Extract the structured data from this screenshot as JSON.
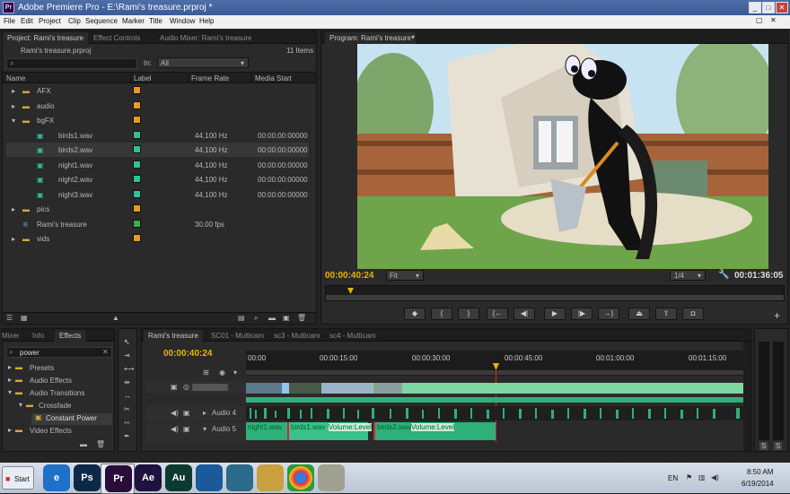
{
  "window": {
    "title": "Adobe Premiere Pro - E:\\Rami's treasure.prproj *",
    "app_icon": "Pr"
  },
  "menu": [
    "File",
    "Edit",
    "Project",
    "Clip",
    "Sequence",
    "Marker",
    "Title",
    "Window",
    "Help"
  ],
  "project_panel": {
    "tabs": [
      "Project: Rami's treasure",
      "Effect Controls",
      "Audio Mixer: Rami's treasure"
    ],
    "file": "Rami's treasure.prproj",
    "item_count": "11 Items",
    "search_placeholder": "",
    "in_label": "In:",
    "in_value": "All",
    "columns": [
      "Name",
      "Label",
      "Frame Rate",
      "Media Start"
    ],
    "rows": [
      {
        "name": "AFX",
        "label_color": "#e89a20",
        "rate": "",
        "start": ""
      },
      {
        "name": "audio",
        "label_color": "#e89a20",
        "rate": "",
        "start": ""
      },
      {
        "name": "bgFX",
        "label_color": "#e89a20",
        "rate": "",
        "start": ""
      },
      {
        "name": "birds1.wav",
        "label_color": "#2ec29a",
        "rate": "44,100 Hz",
        "start": "00:00:00:00000"
      },
      {
        "name": "birds2.wav",
        "label_color": "#2ec29a",
        "rate": "44,100 Hz",
        "start": "00:00:00:00000"
      },
      {
        "name": "night1.wav",
        "label_color": "#2ec29a",
        "rate": "44,100 Hz",
        "start": "00:00:00:00000"
      },
      {
        "name": "night2.wav",
        "label_color": "#2ec29a",
        "rate": "44,100 Hz",
        "start": "00:00:00:00000"
      },
      {
        "name": "night3.wav",
        "label_color": "#2ec29a",
        "rate": "44,100 Hz",
        "start": "00:00:00:00000"
      },
      {
        "name": "pics",
        "label_color": "#e89a20",
        "rate": "",
        "start": ""
      },
      {
        "name": "Rami's treasure",
        "label_color": "#3aad4a",
        "rate": "30.00 fps",
        "start": ""
      },
      {
        "name": "vids",
        "label_color": "#e89a20",
        "rate": "",
        "start": ""
      }
    ]
  },
  "program_monitor": {
    "tab": "Program: Rami's treasure",
    "timecode": "00:00:40:24",
    "fit": "Fit",
    "resolution": "1/4",
    "duration": "00:01:36:05"
  },
  "effects_panel": {
    "tabs": [
      "Mixer",
      "Info",
      "Effects"
    ],
    "search": "power",
    "tree": [
      "Presets",
      "Audio Effects",
      "Audio Transitions",
      "Crossfade",
      "Constant Power",
      "Video Effects"
    ]
  },
  "timeline": {
    "tabs": [
      "Rami's treasure",
      "SC01 - Multicam",
      "sc3 - Multicam",
      "sc4 - Multicam"
    ],
    "timecode": "00:00:40:24",
    "ruler": [
      "00:00",
      "00:00:15:00",
      "00:00:30:00",
      "00:00:45:00",
      "00:01:00:00",
      "00:01:15:00"
    ],
    "tracks": [
      "Audio 4",
      "Audio 5"
    ],
    "clips": [
      "night1.wav",
      "birds1.wav",
      "Volume:Level",
      "birds2.wav",
      "Volume:Level"
    ]
  },
  "taskbar": {
    "start": "Start",
    "language": "EN",
    "time": "8:50 AM",
    "date": "6/19/2014",
    "apps": [
      {
        "label": "e",
        "color": "#1e70c8"
      },
      {
        "label": "Ps",
        "color": "#0c2a48"
      },
      {
        "label": "Pr",
        "color": "#2a0c3a"
      },
      {
        "label": "Ae",
        "color": "#1e1240"
      },
      {
        "label": "Au",
        "color": "#0d3a30"
      },
      {
        "label": "",
        "color": "#1a5a9a"
      },
      {
        "label": "",
        "color": "#2a6a8a"
      },
      {
        "label": "",
        "color": "#c8a040"
      },
      {
        "label": "",
        "color": "#e8e8e8"
      },
      {
        "label": "",
        "color": "#a0a090"
      }
    ]
  }
}
